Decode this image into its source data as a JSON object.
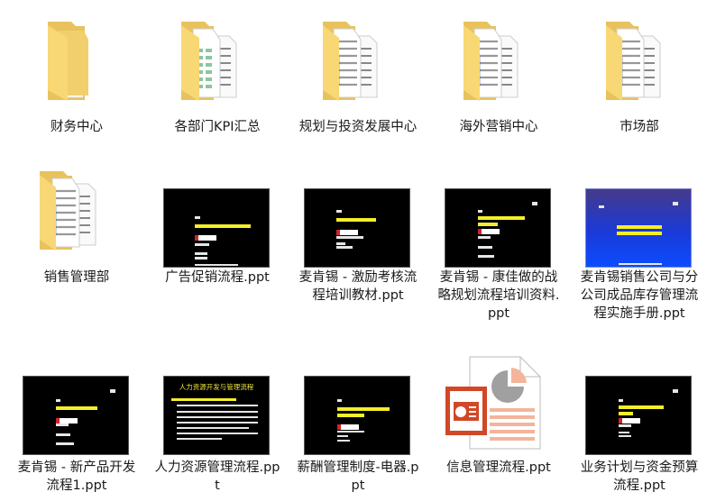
{
  "colors": {
    "folder_front": "#f8d775",
    "folder_back": "#e8c25c",
    "excel_green": "#1e7145",
    "word_blue": "#2b579a",
    "ppt_red": "#d24726",
    "slide_yellow": "#f5ef28"
  },
  "items": [
    {
      "type": "folder",
      "icon": "folder-icon",
      "preview": "images",
      "label": "财务中心"
    },
    {
      "type": "folder",
      "icon": "folder-icon",
      "preview": "excel",
      "label": "各部门KPI汇总"
    },
    {
      "type": "folder",
      "icon": "folder-icon",
      "preview": "word",
      "label": "规划与投资发展中心"
    },
    {
      "type": "folder",
      "icon": "folder-icon",
      "preview": "word",
      "label": "海外营销中心"
    },
    {
      "type": "folder",
      "icon": "folder-icon",
      "preview": "word",
      "label": "市场部"
    },
    {
      "type": "folder",
      "icon": "folder-icon",
      "preview": "word",
      "label": "销售管理部"
    },
    {
      "type": "file",
      "icon": "ppt-thumbnail",
      "preview": "black",
      "label": "广告促销流程.ppt"
    },
    {
      "type": "file",
      "icon": "ppt-thumbnail",
      "preview": "black",
      "label": "麦肯锡 - 激励考核流程培训教材.ppt"
    },
    {
      "type": "file",
      "icon": "ppt-thumbnail",
      "preview": "black",
      "label": "麦肯锡 - 康佳做的战略规划流程培训资料.ppt"
    },
    {
      "type": "file",
      "icon": "ppt-thumbnail",
      "preview": "blue",
      "label": "麦肯锡销售公司与分公司成品库存管理流程实施手册.ppt"
    },
    {
      "type": "file",
      "icon": "ppt-thumbnail",
      "preview": "black",
      "label": "麦肯锡 - 新产品开发流程1.ppt"
    },
    {
      "type": "file",
      "icon": "ppt-thumbnail",
      "preview": "black-titled",
      "slide_title": "人力资源开发与管理流程",
      "label": "人力资源管理流程.ppt"
    },
    {
      "type": "file",
      "icon": "ppt-thumbnail",
      "preview": "black",
      "label": "薪酬管理制度-电器.ppt"
    },
    {
      "type": "file",
      "icon": "powerpoint-file-icon",
      "preview": "generic",
      "label": "信息管理流程.ppt"
    },
    {
      "type": "file",
      "icon": "ppt-thumbnail",
      "preview": "black",
      "label": "业务计划与资金预算流程.ppt"
    }
  ]
}
